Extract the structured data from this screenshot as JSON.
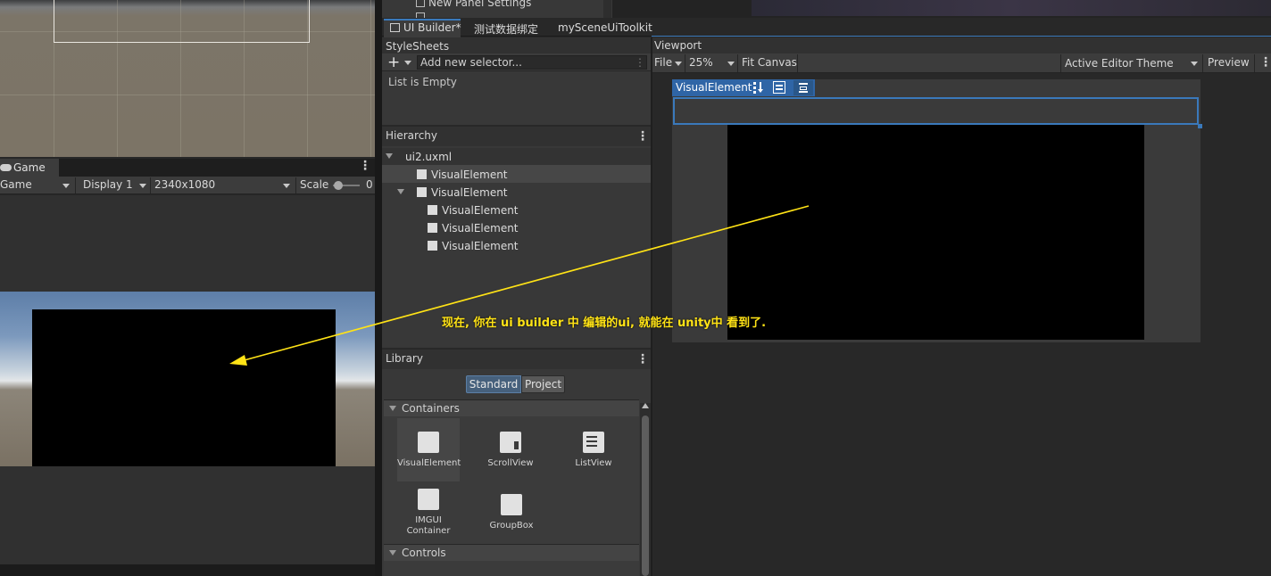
{
  "scene": {
    "project_item": "New Panel Settings"
  },
  "game": {
    "tab_label": "Game",
    "mode": "Game",
    "display": "Display 1",
    "resolution": "2340x1080",
    "scale_label": "Scale",
    "scale_value": "0"
  },
  "ui_builder": {
    "tabs": [
      {
        "label": "UI Builder*"
      },
      {
        "label": "测试数据绑定"
      },
      {
        "label": "mySceneUiToolkit"
      }
    ],
    "stylesheets": {
      "title": "StyleSheets",
      "add_icon": "plus-icon",
      "selector_placeholder": "Add new selector...",
      "empty_text": "List is Empty"
    },
    "hierarchy": {
      "title": "Hierarchy",
      "root": "ui2.uxml",
      "items": [
        {
          "label": "VisualElement",
          "depth": 1,
          "selected": true
        },
        {
          "label": "VisualElement",
          "depth": 1,
          "expanded": true
        },
        {
          "label": "VisualElement",
          "depth": 2
        },
        {
          "label": "VisualElement",
          "depth": 2
        },
        {
          "label": "VisualElement",
          "depth": 2
        }
      ]
    },
    "library": {
      "title": "Library",
      "tabs": [
        "Standard",
        "Project"
      ],
      "active_tab": "Standard",
      "categories": [
        "Containers",
        "Controls"
      ],
      "containers": [
        {
          "label": "VisualElement",
          "icon": "visual-element-icon"
        },
        {
          "label": "ScrollView",
          "icon": "scrollview-icon"
        },
        {
          "label": "ListView",
          "icon": "listview-icon"
        },
        {
          "label_line1": "IMGUI",
          "label_line2": "Container",
          "icon": "imgui-container-icon"
        },
        {
          "label": "GroupBox",
          "icon": "groupbox-icon"
        }
      ]
    },
    "viewport": {
      "title": "Viewport",
      "file_menu": "File",
      "zoom": "25%",
      "fit_canvas": "Fit Canvas",
      "theme": "Active Editor Theme",
      "preview": "Preview",
      "canvas_title": "VisualElement"
    }
  },
  "annotation": {
    "text": "现在, 你在 ui builder 中 编辑的ui, 就能在 unity中 看到了.",
    "color": "#ffe316"
  },
  "colors": {
    "accent": "#3a79bb",
    "selection_header": "#2f65a6",
    "panel": "#383838"
  }
}
